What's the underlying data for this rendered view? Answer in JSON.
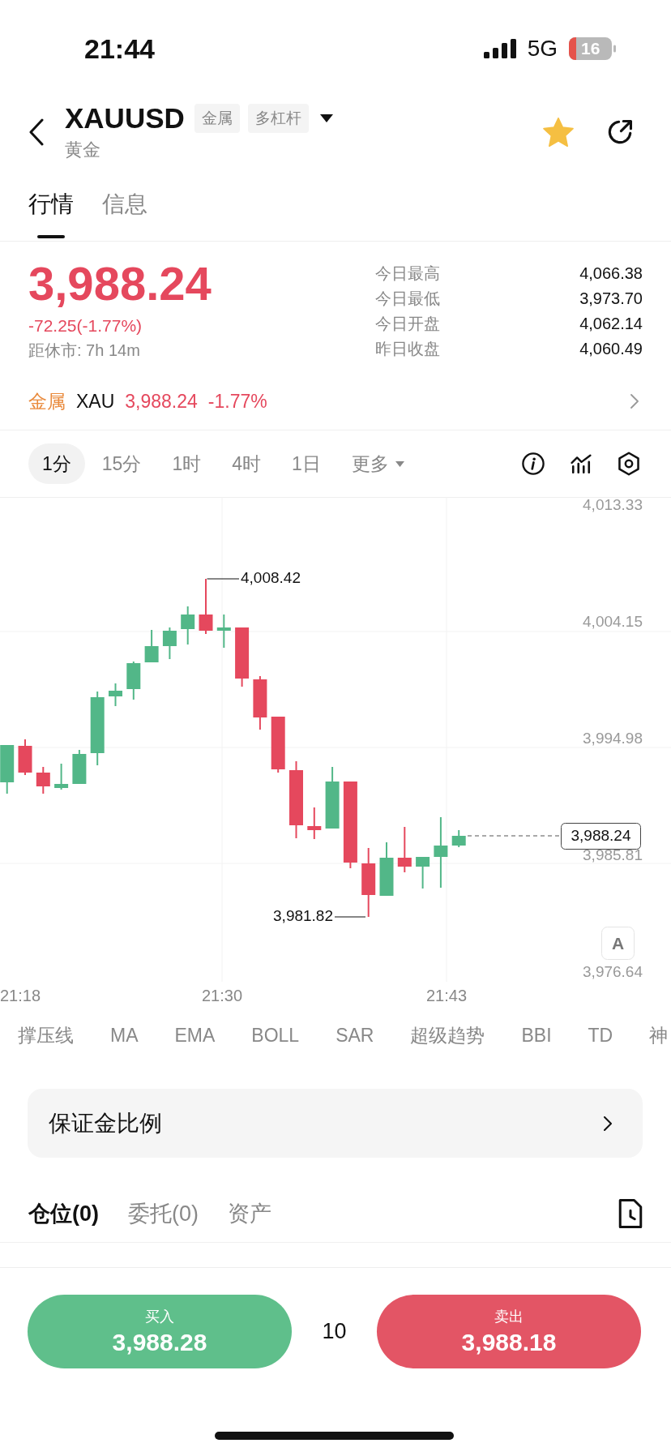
{
  "status_bar": {
    "time": "21:44",
    "network": "5G",
    "battery": "16"
  },
  "header": {
    "symbol": "XAUUSD",
    "tags": [
      "金属",
      "多杠杆"
    ],
    "subtitle": "黄金",
    "favorite": true
  },
  "tabs": [
    {
      "label": "行情",
      "selected": true
    },
    {
      "label": "信息",
      "selected": false
    }
  ],
  "quote": {
    "price": "3,988.24",
    "change": "-72.25(-1.77%)",
    "countdown": "距休市: 7h 14m",
    "stats": [
      {
        "label": "今日最高",
        "value": "4,066.38"
      },
      {
        "label": "今日最低",
        "value": "3,973.70"
      },
      {
        "label": "今日开盘",
        "value": "4,062.14"
      },
      {
        "label": "昨日收盘",
        "value": "4,060.49"
      }
    ]
  },
  "index_row": {
    "category": "金属",
    "symbol": "XAU",
    "price": "3,988.24",
    "change": "-1.77%"
  },
  "timeframes": [
    {
      "label": "1分",
      "selected": true
    },
    {
      "label": "15分",
      "selected": false
    },
    {
      "label": "1时",
      "selected": false
    },
    {
      "label": "4时",
      "selected": false
    },
    {
      "label": "1日",
      "selected": false
    }
  ],
  "more_menu": "更多",
  "chart": {
    "y_axis_labels": [
      "4,013.33",
      "4,004.15",
      "3,994.98",
      "3,985.81",
      "3,976.64"
    ],
    "x_axis_labels": [
      "21:18",
      "21:30",
      "21:43"
    ],
    "high_marker": "4,008.42",
    "low_marker": "3,981.82",
    "last_price_tag": "3,988.24",
    "scale_button": "A"
  },
  "indicators": [
    "撑压线",
    "MA",
    "EMA",
    "BOLL",
    "SAR",
    "超级趋势",
    "BBI",
    "TD",
    "神"
  ],
  "margin_row": "保证金比例",
  "position_tabs": [
    {
      "label": "仓位(0)",
      "selected": true
    },
    {
      "label": "委托(0)",
      "selected": false
    },
    {
      "label": "资产",
      "selected": false
    }
  ],
  "order_bar": {
    "buy": {
      "label": "买入",
      "price": "3,988.28"
    },
    "quantity": "10",
    "sell": {
      "label": "卖出",
      "price": "3,988.18"
    }
  }
}
